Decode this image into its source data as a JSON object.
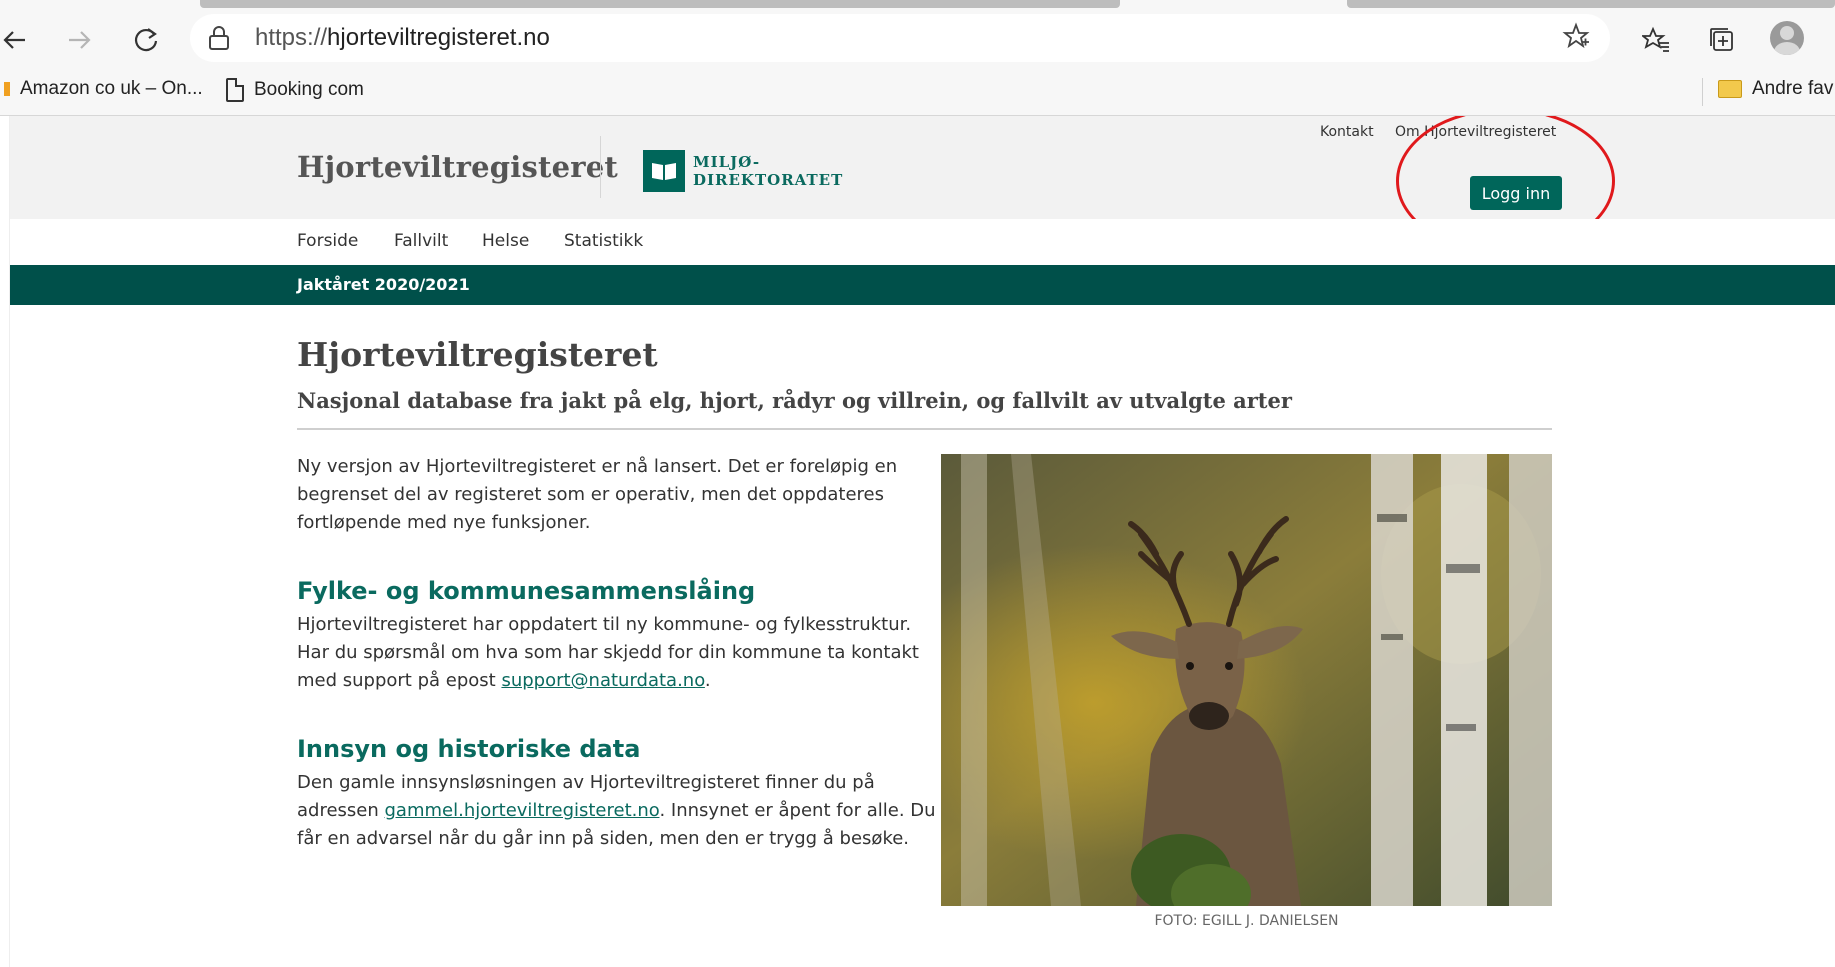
{
  "browser": {
    "url_protocol": "https://",
    "url_host": "hjorteviltregisteret.no",
    "bookmarks": [
      {
        "label": "Amazon co uk – On..."
      },
      {
        "label": "Booking com"
      },
      {
        "label": "Andre fav"
      }
    ],
    "icons": {
      "back": "back-arrow-icon",
      "forward": "forward-arrow-icon",
      "refresh": "refresh-icon",
      "lock": "lock-icon",
      "favorite": "star-icon",
      "favorites_list": "favorites-icon",
      "collections": "collections-icon",
      "profile": "profile-avatar-icon"
    }
  },
  "header": {
    "site_title": "Hjorteviltregisteret",
    "logo_line1": "MILJØ-",
    "logo_line2": "DIREKTORATET",
    "utility_links": [
      "Kontakt",
      "Om Hjorteviltregisteret"
    ],
    "login_label": "Logg inn"
  },
  "nav": {
    "items": [
      "Forside",
      "Fallvilt",
      "Helse",
      "Statistikk"
    ]
  },
  "season": {
    "label": "Jaktåret 2020/2021"
  },
  "content": {
    "title": "Hjorteviltregisteret",
    "subtitle": "Nasjonal database fra jakt på elg, hjort, rådyr og villrein, og fallvilt av utvalgte arter",
    "intro": "Ny versjon av Hjorteviltregisteret er nå lansert. Det er foreløpig en begrenset del av registeret som er operativ, men det oppdateres fortløpende med nye funksjoner.",
    "section1": {
      "heading": "Fylke- og kommunesammenslåing",
      "text_before": "Hjorteviltregisteret har oppdatert til ny kommune- og fylkesstruktur. Har du spørsmål om hva som har skjedd for din kommune ta kontakt med support på epost ",
      "link": "support@naturdata.no",
      "text_after": "."
    },
    "section2": {
      "heading": "Innsyn og historiske data",
      "text_before": "Den gamle innsynsløsningen av Hjorteviltregisteret finner du på adressen ",
      "link": "gammel.hjorteviltregisteret.no",
      "text_after": ". Innsynet er åpent for alle. Du får en advarsel når du går inn på siden, men den er trygg å besøke."
    },
    "photo_caption": "FOTO: EGILL J. DANIELSEN"
  },
  "colors": {
    "brand_green": "#00665a",
    "season_bar": "#00504a",
    "annotation_red": "#e0191c"
  }
}
